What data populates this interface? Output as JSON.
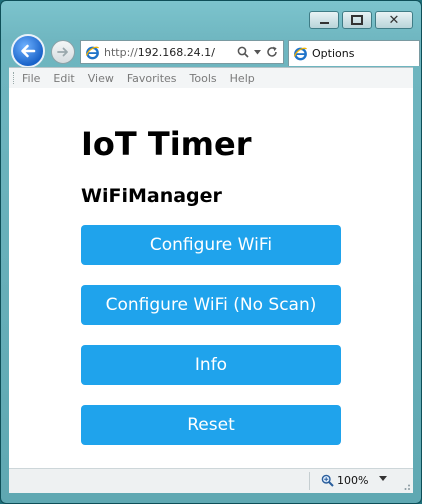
{
  "browser": {
    "address": {
      "protocol": "http://",
      "host": "192.168.24.1",
      "path": "/"
    },
    "tab_title": "Options",
    "menu": [
      "File",
      "Edit",
      "View",
      "Favorites",
      "Tools",
      "Help"
    ],
    "zoom": "100%"
  },
  "page": {
    "title": "IoT Timer",
    "subtitle": "WiFiManager",
    "buttons": {
      "configure_wifi": "Configure WiFi",
      "configure_wifi_no_scan": "Configure WiFi (No Scan)",
      "info": "Info",
      "reset": "Reset"
    },
    "accent_color": "#1fa3ec"
  },
  "icons": {
    "back": "back-arrow-icon",
    "forward": "forward-arrow-icon",
    "search": "search-icon",
    "dropdown": "chevron-down-icon",
    "refresh": "refresh-icon",
    "ie": "ie-logo-icon",
    "zoom": "zoom-icon"
  }
}
